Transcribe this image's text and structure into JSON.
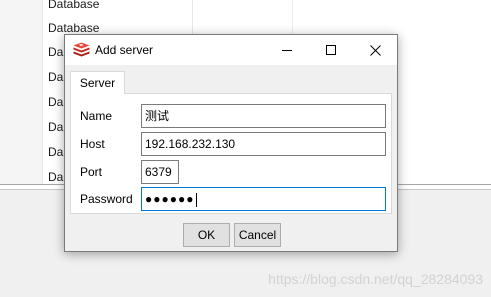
{
  "background": {
    "tree_items": [
      "Database",
      "Database",
      "Da",
      "Da",
      "Da",
      "Da",
      "Da",
      "Da"
    ]
  },
  "dialog": {
    "title": "Add server",
    "icon": "redis-cube-icon",
    "tabs": [
      {
        "label": "Server",
        "selected": true
      }
    ],
    "fields": {
      "name": {
        "label": "Name",
        "value": "测试"
      },
      "host": {
        "label": "Host",
        "value": "192.168.232.130"
      },
      "port": {
        "label": "Port",
        "value": "6379"
      },
      "password": {
        "label": "Password",
        "value": "●●●●●●"
      }
    },
    "buttons": {
      "ok": "OK",
      "cancel": "Cancel"
    },
    "window_controls": [
      "minimize-icon",
      "maximize-icon",
      "close-icon"
    ]
  },
  "watermark": "https://blog.csdn.net/qq_28284093",
  "colors": {
    "dialog_bg": "#f0f0f0",
    "focus_border": "#0078d7",
    "icon_red": "#d82c20"
  }
}
